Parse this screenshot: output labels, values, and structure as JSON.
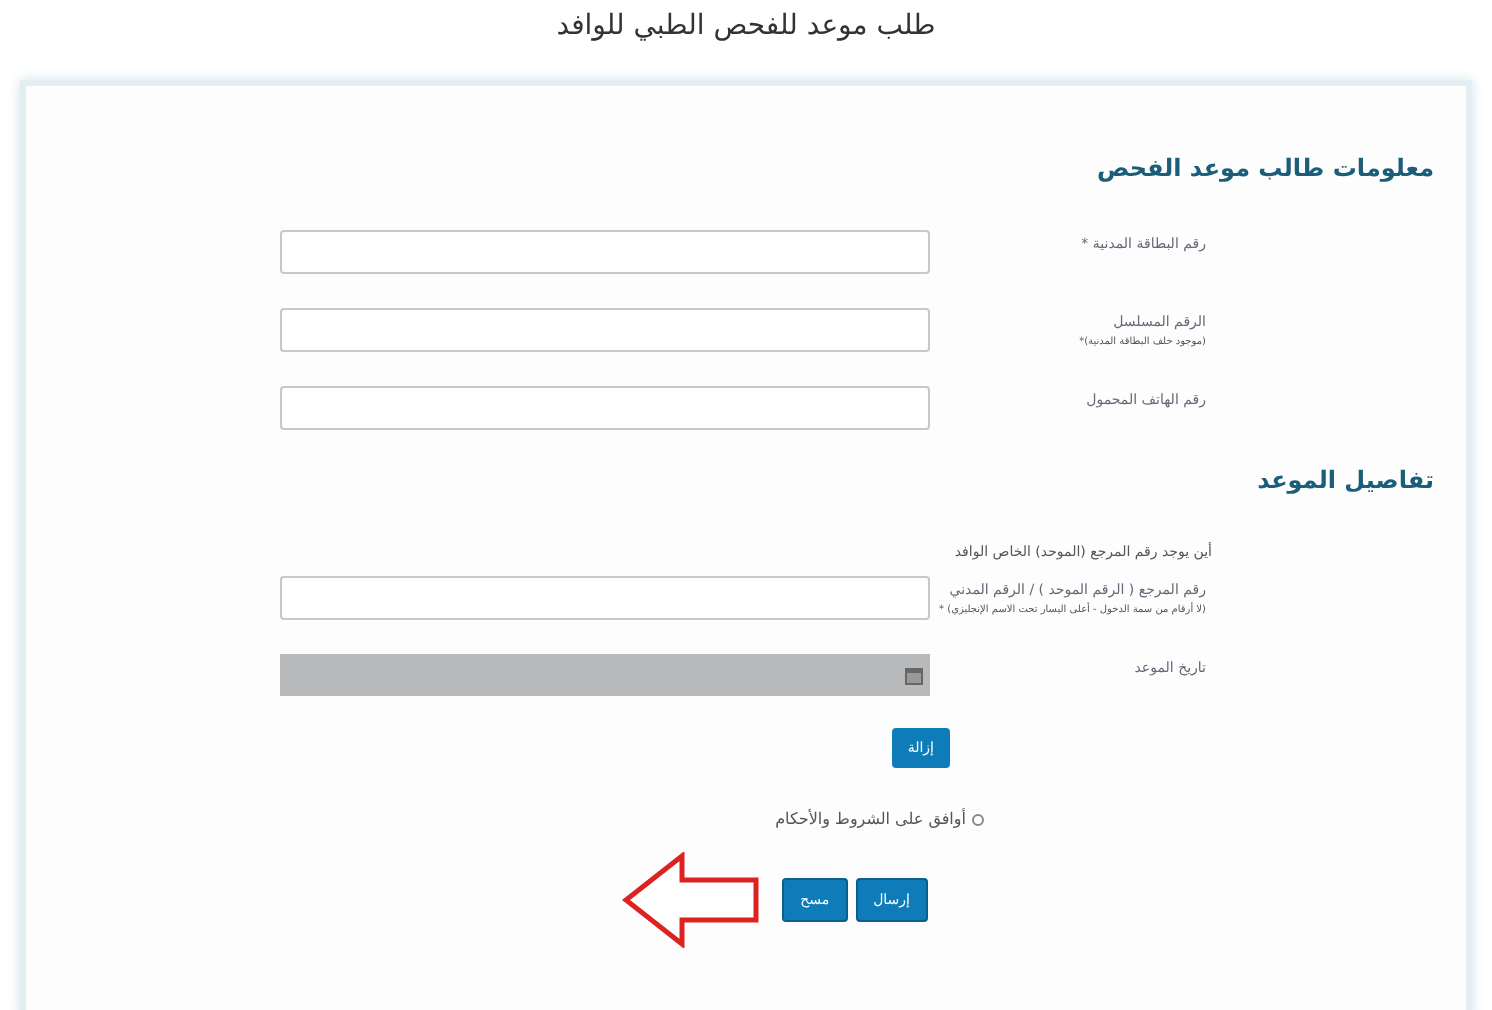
{
  "page_title": "طلب موعد للفحص الطبي للوافد",
  "sections": [
    {
      "heading": "معلومات طالب موعد الفحص",
      "fields": [
        {
          "kind": "text",
          "label": "رقم البطاقة المدنية *"
        },
        {
          "kind": "text",
          "label": "الرقم المسلسل",
          "hint": "(موجود خلف البطاقة المدنية)*"
        },
        {
          "kind": "text",
          "label": "رقم الهاتف المحمول"
        }
      ]
    },
    {
      "heading": "تفاصيل الموعد",
      "help_link": "أين يوجد رقم المرجع (الموحد) الخاص الوافد",
      "fields": [
        {
          "kind": "text",
          "label": "رقم المرجع ( الرقم الموحد ) / الرقم المدني",
          "hint": "(لا أرقام من سمة الدخول - أعلى اليسار تحت الاسم الإنجليزي) *"
        },
        {
          "kind": "date",
          "label": "تاريخ الموعد",
          "disabled": true
        }
      ]
    }
  ],
  "remove_button": "إزالة",
  "terms": {
    "label": "أوافق على الشروط والأحكام",
    "checked": false
  },
  "buttons": [
    "إرسال",
    "مسح"
  ]
}
